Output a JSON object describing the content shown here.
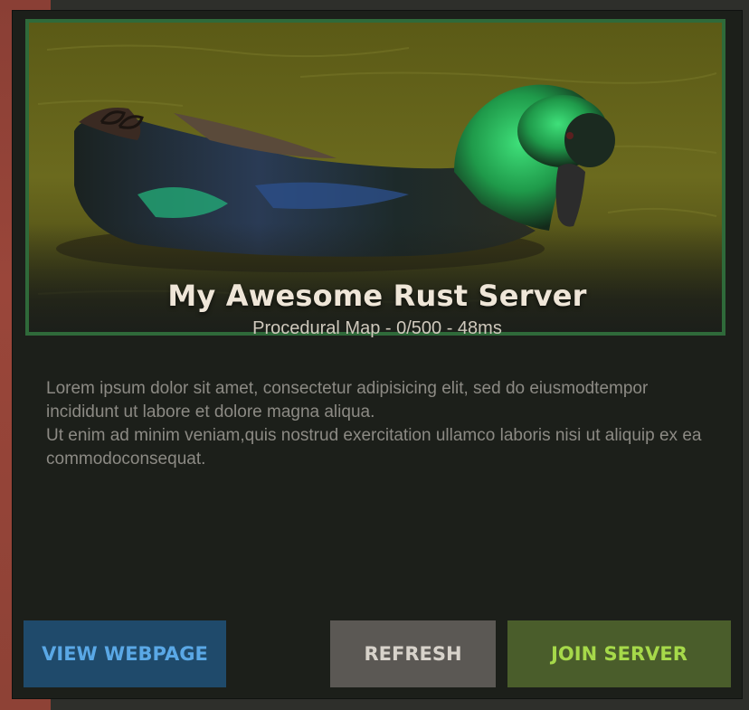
{
  "server": {
    "title": "My Awesome Rust Server",
    "meta": "Procedural Map - 0/500 - 48ms"
  },
  "description": {
    "line1": "Lorem ipsum dolor sit amet, consectetur adipisicing elit, sed do eiusmodtempor incididunt ut labore et dolore magna aliqua.",
    "line2": "Ut enim ad minim veniam,quis nostrud exercitation ullamco laboris nisi ut aliquip ex ea commodoconsequat."
  },
  "buttons": {
    "view_webpage": "VIEW WEBPAGE",
    "refresh": "REFRESH",
    "join_server": "JOIN SERVER"
  },
  "colors": {
    "web_button": "#1f4a6b",
    "refresh_button": "#5b5854",
    "join_button": "#4a5d2b",
    "hero_border": "#2f6a3a"
  },
  "hero": {
    "image": "duck-on-water"
  }
}
